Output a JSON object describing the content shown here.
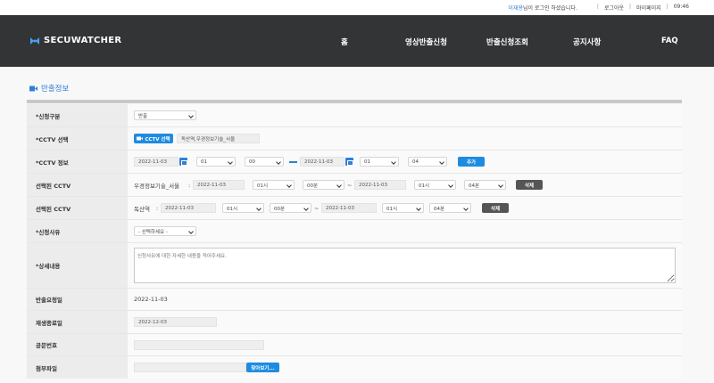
{
  "topbar": {
    "user_name": "이재용",
    "greeting": " 님이 로그인 하셨습니다.",
    "logout": "로그아웃",
    "mypage": "마이페이지",
    "time": "09:46"
  },
  "header": {
    "logo_text": "SECUWATCHER",
    "nav": [
      "홈",
      "영상반출신청",
      "반출신청조회",
      "공지사항",
      "FAQ"
    ]
  },
  "section": {
    "title": "반출정보"
  },
  "form": {
    "type": {
      "label": "*신청구분",
      "value": "반출"
    },
    "cctv_select": {
      "label": "*CCTV 선택",
      "button": "CCTV 선택",
      "value": "독산역,우경정보기술_서울"
    },
    "cctv_info": {
      "label": "*CCTV 정보",
      "start_date": "2022-11-03",
      "start_hour": "01",
      "start_min": "00",
      "end_date": "2022-11-03",
      "end_hour": "01",
      "end_min": "04",
      "add_button": "추가"
    },
    "selected": [
      {
        "label": "선택된 CCTV",
        "name": "우경정보기술_서울",
        "colon": ":",
        "start_date": "2022-11-03",
        "start_hour": "01시",
        "start_min": "00분",
        "tilde": "~",
        "end_date": "2022-11-03",
        "end_hour": "01시",
        "end_min": "04분",
        "delete": "삭제"
      },
      {
        "label": "선택된 CCTV",
        "name": "독산역",
        "colon": ":",
        "start_date": "2022-11-03",
        "start_hour": "01시",
        "start_min": "00분",
        "tilde": "~",
        "end_date": "2022-11-03",
        "end_hour": "01시",
        "end_min": "04분",
        "delete": "삭제"
      }
    ],
    "reason": {
      "label": "*신청사유",
      "value": "- 선택하세요 -"
    },
    "detail": {
      "label": "*상세내용",
      "placeholder": "신청사유에 대한 자세한 내용을 적어주세요."
    },
    "request_date": {
      "label": "반출요청일",
      "value": "2022-11-03"
    },
    "play_end": {
      "label": "재생종료일",
      "value": "2022-12-03"
    },
    "doc_no": {
      "label": "공문번호",
      "value": ""
    },
    "attachment": {
      "label": "첨부파일",
      "button": "찾아보기..."
    }
  },
  "colors": {
    "accent": "#2f7fd8",
    "header_bg": "#333436",
    "button_blue": "#1f8be0",
    "button_gray": "#555555"
  }
}
